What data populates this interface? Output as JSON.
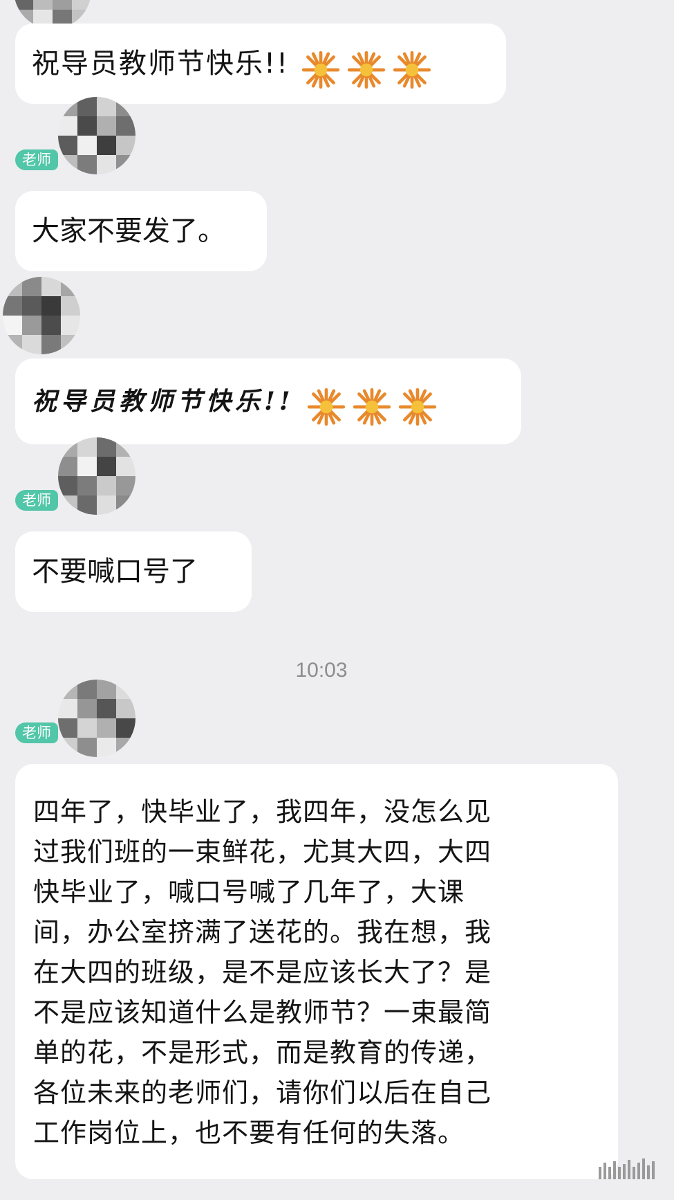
{
  "chat": {
    "messages": [
      {
        "text": "祝导员教师节快乐!!",
        "emoji": "firework-emoji"
      },
      {
        "role": "老师",
        "text": "大家不要发了。"
      },
      {
        "text": "祝导员教师节快乐!!",
        "emoji": "firework-emoji"
      },
      {
        "role": "老师",
        "text": "不要喊口号了"
      },
      {
        "role": "老师",
        "text": "四年了，快毕业了，我四年，没怎么见\n过我们班的一束鲜花，尤其大四，大四\n快毕业了，喊口号喊了几年了，大课\n间，办公室挤满了送花的。我在想，我\n在大四的班级，是不是应该长大了？是\n不是应该知道什么是教师节？一束最简\n单的花，不是形式，而是教育的传递，\n各位未来的老师们，请你们以后在自己\n工作岗位上，也不要有任何的失落。"
      }
    ],
    "timestamp": "10:03"
  },
  "colors": {
    "background": "#eeeef1",
    "bubble": "#ffffff",
    "badge": "#52c6a8",
    "firework_outer": "#e8892c",
    "firework_inner": "#f6c13a"
  }
}
